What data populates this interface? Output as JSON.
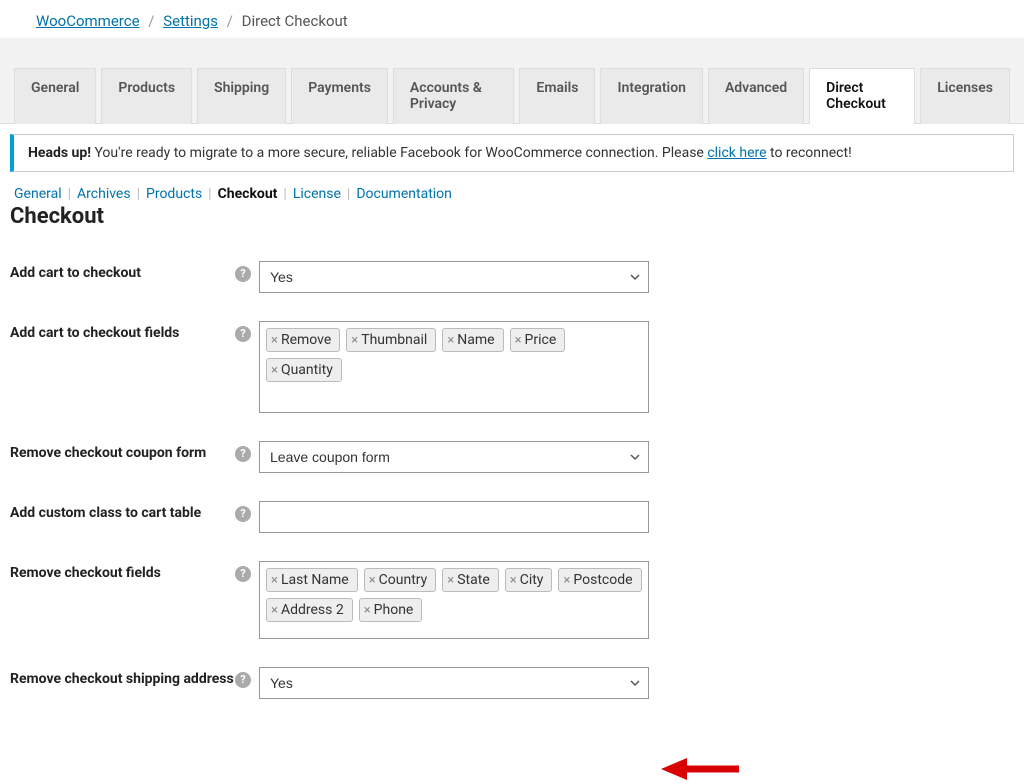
{
  "breadcrumb": {
    "root": "WooCommerce",
    "mid": "Settings",
    "current": "Direct Checkout"
  },
  "tabs": [
    "General",
    "Products",
    "Shipping",
    "Payments",
    "Accounts & Privacy",
    "Emails",
    "Integration",
    "Advanced",
    "Direct Checkout",
    "Licenses"
  ],
  "active_tab": "Direct Checkout",
  "notice": {
    "lead": "Heads up!",
    "text": " You're ready to migrate to a more secure, reliable Facebook for WooCommerce connection. Please ",
    "link": "click here",
    "after": " to reconnect!"
  },
  "subnav": [
    "General",
    "Archives",
    "Products",
    "Checkout",
    "License",
    "Documentation"
  ],
  "subnav_current": "Checkout",
  "section_title": "Checkout",
  "rows": {
    "add_cart": {
      "label": "Add cart to checkout",
      "value": "Yes"
    },
    "add_cart_fields": {
      "label": "Add cart to checkout fields",
      "tags": [
        "Remove",
        "Thumbnail",
        "Name",
        "Price",
        "Quantity"
      ]
    },
    "remove_coupon": {
      "label": "Remove checkout coupon form",
      "value": "Leave coupon form"
    },
    "custom_class": {
      "label": "Add custom class to cart table",
      "value": ""
    },
    "remove_fields": {
      "label": "Remove checkout fields",
      "tags": [
        "Last Name",
        "Country",
        "State",
        "City",
        "Postcode",
        "Address 2",
        "Phone"
      ]
    },
    "remove_shipping": {
      "label": "Remove checkout shipping address",
      "value": "Yes"
    }
  },
  "icons": {
    "help": "?"
  }
}
